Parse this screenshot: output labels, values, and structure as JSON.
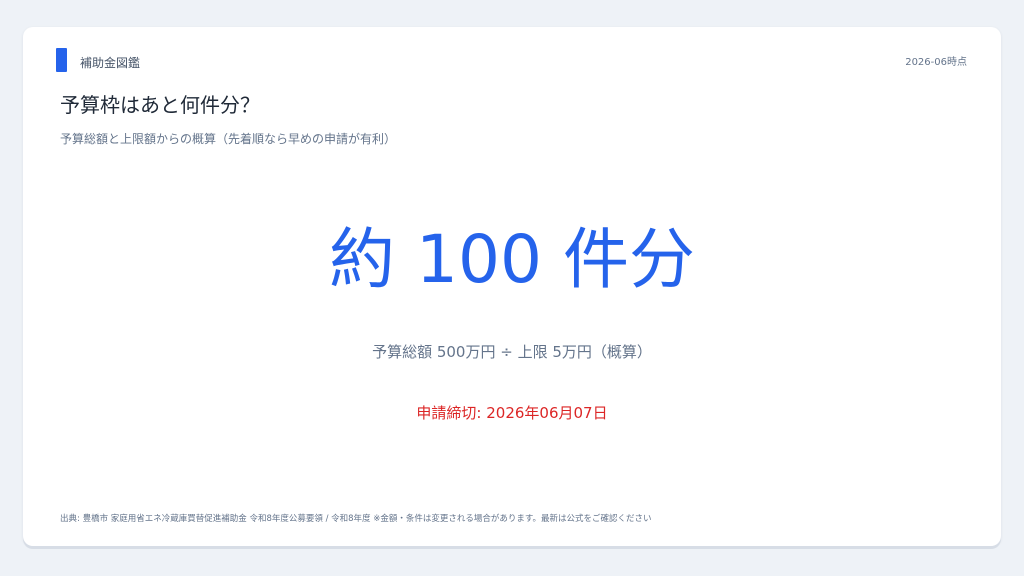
{
  "colors": {
    "accent": "#2563eb",
    "big_number": "#2563eb",
    "deadline": "#dc2626"
  },
  "header": {
    "brand": "補助金図鑑",
    "as_of": "2026-06時点"
  },
  "main": {
    "title": "予算枠はあと何件分？",
    "subtitle": "予算総額と上限額からの概算（先着順なら早めの申請が有利）",
    "big_number": "約 100 件分",
    "formula": "予算総額 500万円 ÷ 上限 5万円（概算）",
    "deadline": "申請締切: 2026年06月07日"
  },
  "footer": {
    "source": "出典: 豊橋市 家庭用省エネ冷蔵庫買替促進補助金 令和8年度公募要領 / 令和8年度 ※金額・条件は変更される場合があります。最新は公式をご確認ください"
  }
}
